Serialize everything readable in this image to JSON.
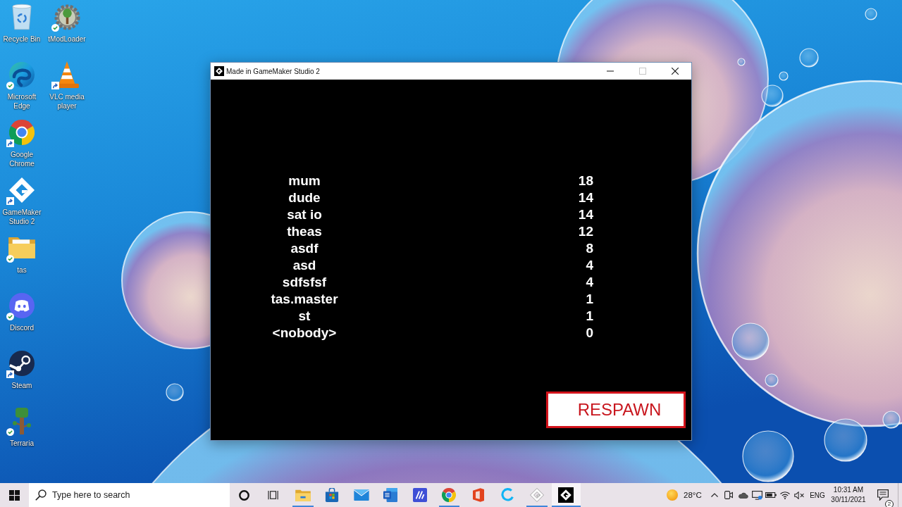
{
  "desktop": {
    "icons": [
      {
        "label": "Recycle Bin",
        "synced": false,
        "shortcut": false
      },
      {
        "label": "Microsoft Edge",
        "synced": true,
        "shortcut": false
      },
      {
        "label": "Google Chrome",
        "synced": false,
        "shortcut": true
      },
      {
        "label": "GameMaker Studio 2",
        "synced": false,
        "shortcut": true
      },
      {
        "label": "tas",
        "synced": true,
        "shortcut": false
      },
      {
        "label": "Discord",
        "synced": true,
        "shortcut": false
      },
      {
        "label": "Steam",
        "synced": false,
        "shortcut": true
      },
      {
        "label": "Terraria",
        "synced": true,
        "shortcut": false
      },
      {
        "label": "tModLoader",
        "synced": true,
        "shortcut": false
      },
      {
        "label": "VLC media player",
        "synced": false,
        "shortcut": true
      }
    ]
  },
  "window": {
    "title": "Made in GameMaker Studio 2",
    "controls": [
      {
        "kind": "minimize",
        "disabled": false
      },
      {
        "kind": "maximize",
        "disabled": true
      },
      {
        "kind": "close",
        "disabled": false
      }
    ]
  },
  "game": {
    "scores": [
      {
        "name": "mum",
        "score": "18"
      },
      {
        "name": "dude",
        "score": "14"
      },
      {
        "name": "sat io",
        "score": "14"
      },
      {
        "name": "theas",
        "score": "12"
      },
      {
        "name": "asdf",
        "score": "8"
      },
      {
        "name": "asd",
        "score": "4"
      },
      {
        "name": "sdfsfsf",
        "score": "4"
      },
      {
        "name": "tas.master",
        "score": "1"
      },
      {
        "name": "st",
        "score": "1"
      },
      {
        "name": "<nobody>",
        "score": "0"
      }
    ],
    "respawn_button": "RESPAWN"
  },
  "taskbar": {
    "search": {
      "placeholder": "Type here to search"
    },
    "apps": [
      {
        "running": true,
        "selected": false
      },
      {
        "running": false,
        "selected": false
      },
      {
        "running": false,
        "selected": false
      },
      {
        "running": false,
        "selected": false
      },
      {
        "running": false,
        "selected": false
      },
      {
        "running": true,
        "selected": false
      },
      {
        "running": false,
        "selected": false
      },
      {
        "running": false,
        "selected": false
      },
      {
        "running": true,
        "selected": false
      },
      {
        "running": true,
        "selected": true
      }
    ],
    "weather": {
      "temperature": "28°C"
    },
    "language": "ENG",
    "clock": {
      "time": "10:31 AM",
      "date": "30/11/2021"
    },
    "notifications": {
      "count": "2"
    }
  }
}
